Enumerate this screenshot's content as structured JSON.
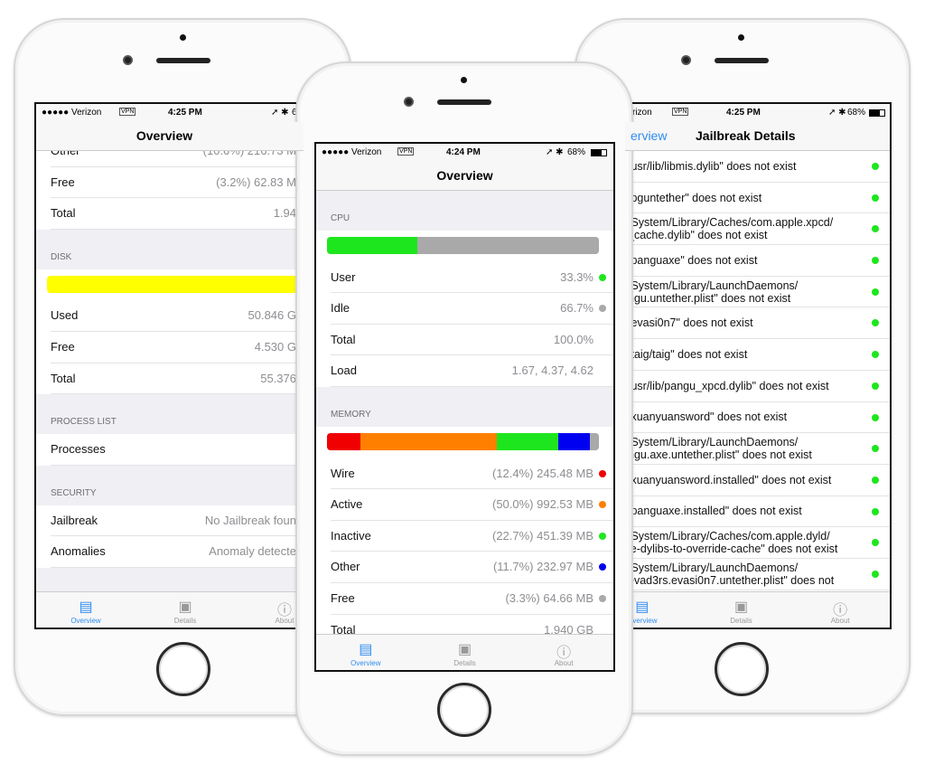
{
  "colors": {
    "green": "#1ee61e",
    "grey": "#a9a9a9",
    "red": "#f00000",
    "orange": "#ff8000",
    "blue": "#0000f0",
    "yellow": "#ffff00",
    "accent": "#2f8cf0"
  },
  "tabs": [
    {
      "label": "Overview",
      "icon": "document-icon"
    },
    {
      "label": "Details",
      "icon": "chip-icon"
    },
    {
      "label": "About",
      "icon": "info-icon"
    }
  ],
  "left": {
    "status": {
      "carrier": "●●●●● Verizon",
      "vpn": "VPN",
      "time": "4:25 PM",
      "battery": "6"
    },
    "title": "Overview",
    "memory_rows": [
      {
        "label": "Other",
        "value": "(10.6%) 216.73 M"
      },
      {
        "label": "Free",
        "value": "(3.2%) 62.83 M"
      },
      {
        "label": "Total",
        "value": "1.94"
      }
    ],
    "disk": {
      "header": "DISK",
      "fill_percent": 100,
      "rows": [
        {
          "label": "Used",
          "value": "50.846 G"
        },
        {
          "label": "Free",
          "value": "4.530 G"
        },
        {
          "label": "Total",
          "value": "55.376"
        }
      ]
    },
    "process": {
      "header": "PROCESS LIST",
      "rows": [
        {
          "label": "Processes"
        }
      ]
    },
    "security": {
      "header": "SECURITY",
      "rows": [
        {
          "label": "Jailbreak",
          "value": "No Jailbreak foun"
        },
        {
          "label": "Anomalies",
          "value": "Anomaly detecte"
        }
      ]
    }
  },
  "middle": {
    "status": {
      "carrier": "●●●●● Verizon",
      "vpn": "VPN",
      "time": "4:24 PM",
      "battery": "68%"
    },
    "title": "Overview",
    "cpu": {
      "header": "CPU",
      "segments": [
        {
          "percent": 33.3,
          "color": "#1ee61e"
        },
        {
          "percent": 66.7,
          "color": "#a9a9a9"
        }
      ],
      "rows": [
        {
          "label": "User",
          "value": "33.3%",
          "color": "#1ee61e"
        },
        {
          "label": "Idle",
          "value": "66.7%",
          "color": "#a9a9a9"
        },
        {
          "label": "Total",
          "value": "100.0%"
        },
        {
          "label": "Load",
          "value": "1.67, 4.37, 4.62"
        }
      ]
    },
    "memory": {
      "header": "MEMORY",
      "segments": [
        {
          "percent": 12.4,
          "color": "#f00000"
        },
        {
          "percent": 50.0,
          "color": "#ff8000"
        },
        {
          "percent": 22.7,
          "color": "#1ee61e"
        },
        {
          "percent": 11.7,
          "color": "#0000f0"
        },
        {
          "percent": 3.3,
          "color": "#a9a9a9"
        }
      ],
      "rows": [
        {
          "label": "Wire",
          "value": "(12.4%) 245.48 MB",
          "color": "#f00000"
        },
        {
          "label": "Active",
          "value": "(50.0%) 992.53 MB",
          "color": "#ff8000"
        },
        {
          "label": "Inactive",
          "value": "(22.7%) 451.39 MB",
          "color": "#1ee61e"
        },
        {
          "label": "Other",
          "value": "(11.7%) 232.97 MB",
          "color": "#0000f0"
        },
        {
          "label": "Free",
          "value": "(3.3%) 64.66 MB",
          "color": "#a9a9a9"
        },
        {
          "label": "Total",
          "value": "1.940 GB"
        }
      ]
    }
  },
  "right": {
    "status": {
      "carrier": "rizon",
      "vpn": "VPN",
      "time": "4:25 PM",
      "battery": "68%"
    },
    "back": "erview",
    "title": "Jailbreak Details",
    "items": [
      "/usr/lib/libmis.dylib\" does not exist",
      "/pguntether\" does not exist",
      "/System/Library/Caches/com.apple.xpcd/\n_cache.dylib\" does not exist",
      "/panguaxe\" does not exist",
      "/System/Library/LaunchDaemons/\nngu.untether.plist\" does not exist",
      "/evasi0n7\" does not exist",
      "/taig/taig\" does not exist",
      "/usr/lib/pangu_xpcd.dylib\" does not exist",
      "/xuanyuansword\" does not exist",
      "/System/Library/LaunchDaemons/\nngu.axe.untether.plist\" does not exist",
      "/xuanyuansword.installed\" does not exist",
      "/panguaxe.installed\" does not exist",
      "/System/Library/Caches/com.apple.dyld/\nle-dylibs-to-override-cache\" does not exist",
      "/System/Library/LaunchDaemons/\nevad3rs.evasi0n7.untether.plist\" does not"
    ]
  }
}
